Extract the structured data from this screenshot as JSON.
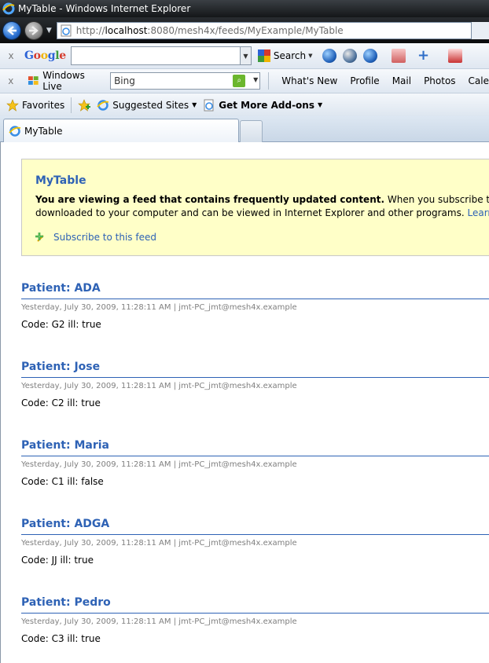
{
  "window": {
    "title": "MyTable - Windows Internet Explorer"
  },
  "address": {
    "url_prefix": "http://",
    "url_host": "localhost",
    "url_rest": ":8080/mesh4x/feeds/MyExample/MyTable"
  },
  "google_toolbar": {
    "close": "x",
    "logo": "Google",
    "search_value": "",
    "search_button": "Search"
  },
  "live_toolbar": {
    "close": "x",
    "brand": "Windows Live",
    "search_value": "Bing",
    "links": [
      "What's New",
      "Profile",
      "Mail",
      "Photos",
      "Cale"
    ]
  },
  "favorites_bar": {
    "favorites": "Favorites",
    "suggested_sites": "Suggested Sites",
    "addons": "Get More Add-ons"
  },
  "tabs": [
    {
      "label": "MyTable"
    }
  ],
  "feed": {
    "title": "MyTable",
    "desc_bold": "You are viewing a feed that contains frequently updated content.",
    "desc_rest": " When you subscribe to a feed",
    "desc_line2": "downloaded to your computer and can be viewed in Internet Explorer and other programs.",
    "learn_more": " Learn m",
    "subscribe_label": "Subscribe to this feed"
  },
  "entries": [
    {
      "title": "Patient: ADA",
      "meta": "Yesterday, July 30, 2009, 11:28:11 AM | jmt-PC_jmt@mesh4x.example",
      "body": "Code: G2 ill: true"
    },
    {
      "title": "Patient: Jose",
      "meta": "Yesterday, July 30, 2009, 11:28:11 AM | jmt-PC_jmt@mesh4x.example",
      "body": "Code: C2 ill: true"
    },
    {
      "title": "Patient: Maria",
      "meta": "Yesterday, July 30, 2009, 11:28:11 AM | jmt-PC_jmt@mesh4x.example",
      "body": "Code: C1 ill: false"
    },
    {
      "title": "Patient: ADGA",
      "meta": "Yesterday, July 30, 2009, 11:28:11 AM | jmt-PC_jmt@mesh4x.example",
      "body": "Code: JJ ill: true"
    },
    {
      "title": "Patient: Pedro",
      "meta": "Yesterday, July 30, 2009, 11:28:11 AM | jmt-PC_jmt@mesh4x.example",
      "body": "Code: C3 ill: true"
    }
  ],
  "colors": {
    "link_blue": "#2e62b5",
    "feed_box_bg": "#ffffc8"
  }
}
